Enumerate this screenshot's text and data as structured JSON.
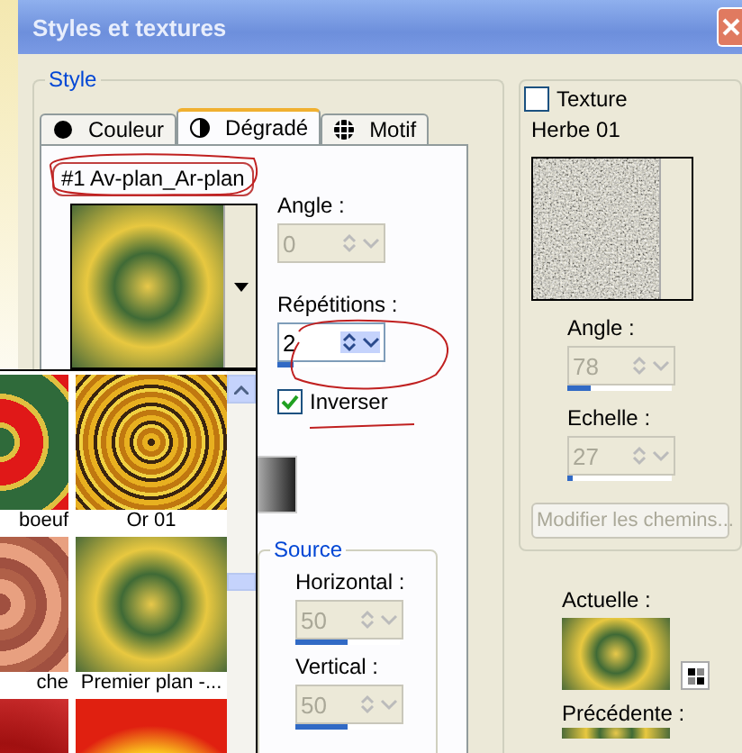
{
  "window": {
    "title": "Styles et textures"
  },
  "style_group": {
    "legend": "Style",
    "tabs": [
      {
        "label": "Couleur",
        "kind": "dot",
        "selected": false
      },
      {
        "label": "Dégradé",
        "kind": "half",
        "selected": true
      },
      {
        "label": "Motif",
        "kind": "grid",
        "selected": false
      }
    ],
    "gradient_name": "#1 Av-plan_Ar-plan",
    "angle": {
      "label": "Angle :",
      "value": "0",
      "disabled": true
    },
    "repetitions": {
      "label": "Répétitions :",
      "value": "2",
      "level": 0.15,
      "disabled": false
    },
    "invert": {
      "label": "Inverser",
      "checked": true
    },
    "source": {
      "legend": "Source",
      "horizontal": {
        "label": "Horizontal :",
        "value": "50",
        "level": 0.5,
        "disabled": true
      },
      "vertical": {
        "label": "Vertical :",
        "value": "50",
        "level": 0.5,
        "disabled": true
      }
    }
  },
  "gradient_list": {
    "items": [
      {
        "kind": "red-green",
        "label": "boeuf"
      },
      {
        "kind": "gold-rings",
        "label": "Or 01"
      },
      {
        "kind": "brown",
        "label": "che"
      },
      {
        "kind": "yellow-green",
        "label": "Premier plan -..."
      },
      {
        "kind": "red"
      },
      {
        "kind": "red-yellow"
      }
    ]
  },
  "texture": {
    "label": "Texture",
    "checked": false,
    "name": "Herbe 01",
    "angle": {
      "label": "Angle :",
      "value": "78",
      "level": 0.22,
      "disabled": true
    },
    "scale": {
      "label": "Echelle :",
      "value": "27",
      "level": 0.05,
      "disabled": true
    },
    "button": {
      "label": "Modifier les chemins...",
      "disabled": true
    }
  },
  "current": {
    "label": "Actuelle :"
  },
  "previous": {
    "label": "Précédente :"
  }
}
